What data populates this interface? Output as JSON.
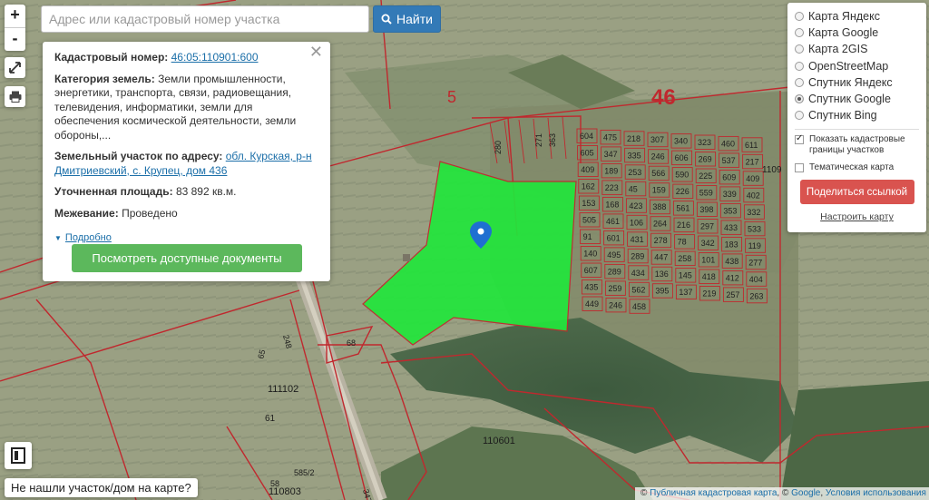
{
  "search": {
    "placeholder": "Адрес или кадастровый номер участка",
    "button_label": "Найти"
  },
  "zoom": {
    "in": "+",
    "out": "-"
  },
  "tools": [
    {
      "icon": "fullscreen-icon"
    },
    {
      "icon": "print-icon"
    },
    {
      "icon": "legend-icon"
    }
  ],
  "info": {
    "cadastral_label": "Кадастровый номер:",
    "cadastral_value": "46:05:110901:600",
    "category_label": "Категория земель:",
    "category_value": "Земли промышленности, энергетики, транспорта, связи, радиовещания, телевидения, информатики, земли для обеспечения космической деятельности, земли обороны,...",
    "address_label": "Земельный участок по адресу:",
    "address_value": "обл. Курская, р-н Дмитриевский, с. Крупец, дом 436",
    "area_label": "Уточненная площадь:",
    "area_value": "83 892 кв.м.",
    "survey_label": "Межевание:",
    "survey_value": "Проведено",
    "more_label": "Подробно",
    "docs_button": "Посмотреть доступные документы"
  },
  "layers": {
    "options": [
      {
        "label": "Карта Яндекс",
        "selected": false
      },
      {
        "label": "Карта Google",
        "selected": false
      },
      {
        "label": "Карта 2GIS",
        "selected": false
      },
      {
        "label": "OpenStreetMap",
        "selected": false
      },
      {
        "label": "Спутник Яндекс",
        "selected": false
      },
      {
        "label": "Спутник Google",
        "selected": true
      },
      {
        "label": "Спутник Bing",
        "selected": false
      }
    ],
    "show_borders": "Показать кадастровые границы участков",
    "thematic": "Тематическая карта",
    "share_button": "Поделиться ссылкой",
    "setup_link": "Настроить карту"
  },
  "not_found": "Не нашли участок/дом на карте?",
  "attribution": {
    "copy": "©",
    "pkk": "Публичная кадастровая карта",
    "sep": ", ©",
    "google": "Google",
    "terms": "Условия использования"
  },
  "map_labels": {
    "big46": "46",
    "big5": "5",
    "l110601": "110601",
    "l111102": "111102",
    "l110803": "110803",
    "l61": "61",
    "l65": "65",
    "l68": "68",
    "l585": "585/2",
    "l58": "58",
    "l347": "347",
    "l248": "248",
    "l280": "280",
    "l271": "271",
    "l363": "363",
    "l1109": "1109"
  },
  "plot_numbers": [
    "604",
    "475",
    "218",
    "307",
    "340",
    "323",
    "460",
    "611",
    "605",
    "347",
    "335",
    "246",
    "606",
    "269",
    "537",
    "217",
    "409",
    "189",
    "253",
    "566",
    "590",
    "225",
    "609",
    "409",
    "162",
    "223",
    "45",
    "159",
    "226",
    "559",
    "339",
    "402",
    "153",
    "168",
    "423",
    "388",
    "561",
    "398",
    "353",
    "332",
    "505",
    "461",
    "106",
    "264",
    "216",
    "297",
    "433",
    "533",
    "91",
    "601",
    "431",
    "278",
    "78",
    "342",
    "183",
    "119",
    "140",
    "495",
    "289",
    "447",
    "258",
    "101",
    "438",
    "277",
    "607",
    "289",
    "434",
    "136",
    "145",
    "418",
    "412",
    "404",
    "435",
    "259",
    "562",
    "395",
    "137",
    "219",
    "257",
    "263",
    "449",
    "246",
    "458"
  ],
  "colors": {
    "parcel_fill": "#22e63c",
    "boundary": "#c0282e",
    "accent": "#337ab7",
    "green_button": "#5cb85c",
    "red_button": "#d9534f"
  }
}
